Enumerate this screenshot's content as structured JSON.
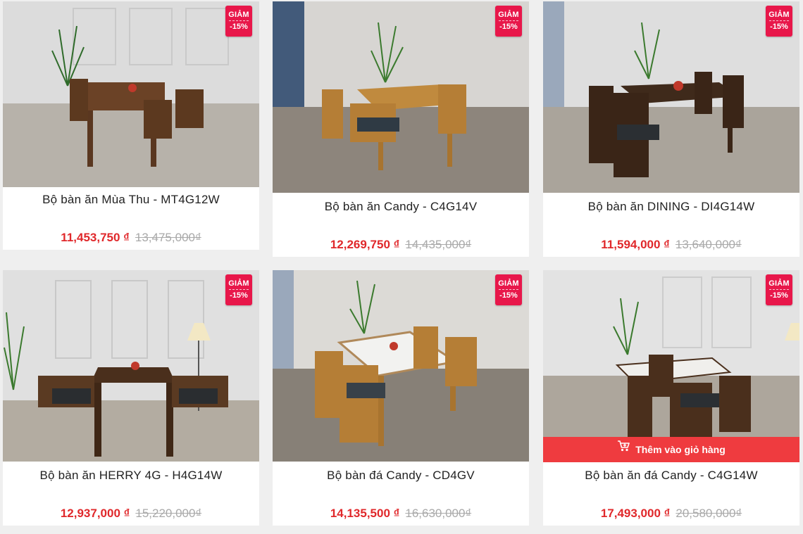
{
  "badge": {
    "line1": "GIẢM",
    "line2": "-15%"
  },
  "cart_button_label": "Thêm vào giỏ hàng",
  "products": [
    {
      "title": "Bộ bàn ăn Mùa Thu - MT4G12W",
      "price": "11,453,750 ₫",
      "old_price": "13,475,000₫"
    },
    {
      "title": "Bộ bàn ăn Candy - C4G14V",
      "price": "12,269,750 ₫",
      "old_price": "14,435,000₫"
    },
    {
      "title": "Bộ bàn ăn DINING - DI4G14W",
      "price": "11,594,000 ₫",
      "old_price": "13,640,000₫"
    },
    {
      "title": "Bộ bàn ăn HERRY 4G - H4G14W",
      "price": "12,937,000 ₫",
      "old_price": "15,220,000₫"
    },
    {
      "title": "Bộ bàn đá Candy - CD4GV",
      "price": "14,135,500 ₫",
      "old_price": "16,630,000₫"
    },
    {
      "title": "Bộ bàn ăn đá Candy - C4G14W",
      "price": "17,493,000 ₫",
      "old_price": "20,580,000₫"
    }
  ],
  "colors": {
    "badge": "#e8174a",
    "price": "#e0282b",
    "cart_button": "#ef3b3f"
  }
}
